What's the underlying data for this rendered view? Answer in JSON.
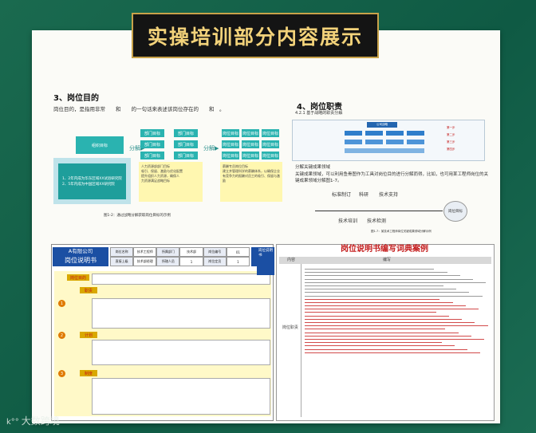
{
  "page_title": "实操培训部分内容展示",
  "purpose": {
    "heading": "3、岗位目的",
    "line1": "岗位目的，是指用非常　　和　　的一句话来表述该岗位存在的　　和　。",
    "caption": "图1-2：通过战略分解获取岗位目标的示例"
  },
  "duty": {
    "heading": "4、岗位职责",
    "sub": "4.2.1 基于战略的职责分解",
    "text1": "分解关键成果领域",
    "text2": "关键成果领域，可以利用鱼骨图作为工具对岗位目的进行分解而得，比如，也可用某工程师岗位的关键成果领域分解图1-7。",
    "fish": [
      "标准制订",
      "科研",
      "技术支持",
      "技术培训",
      "技术检测",
      "岗位目标"
    ],
    "caption": "图1-7：某技术工程师岗位关键成果领域分解示例"
  },
  "jd": {
    "company": "A有限公司",
    "doc_title": "岗位说明书",
    "header_cells": [
      "岗位名称",
      "技术工程师",
      "所属部门",
      "技术部",
      "岗位编号",
      "01",
      "直接上级",
      "技术部经理",
      "所辖人员",
      "1",
      "岗位定员",
      "1"
    ],
    "sections": [
      "岗位目的",
      "职责",
      "计划",
      "制度"
    ],
    "side": "岗位说明书"
  },
  "dict": {
    "title": "岗位说明书编写词典案例",
    "col1": "内容",
    "col2": "编写",
    "row_label": "岗位职责"
  },
  "watermark": "大数跨境",
  "watermark_logo": "k°°"
}
